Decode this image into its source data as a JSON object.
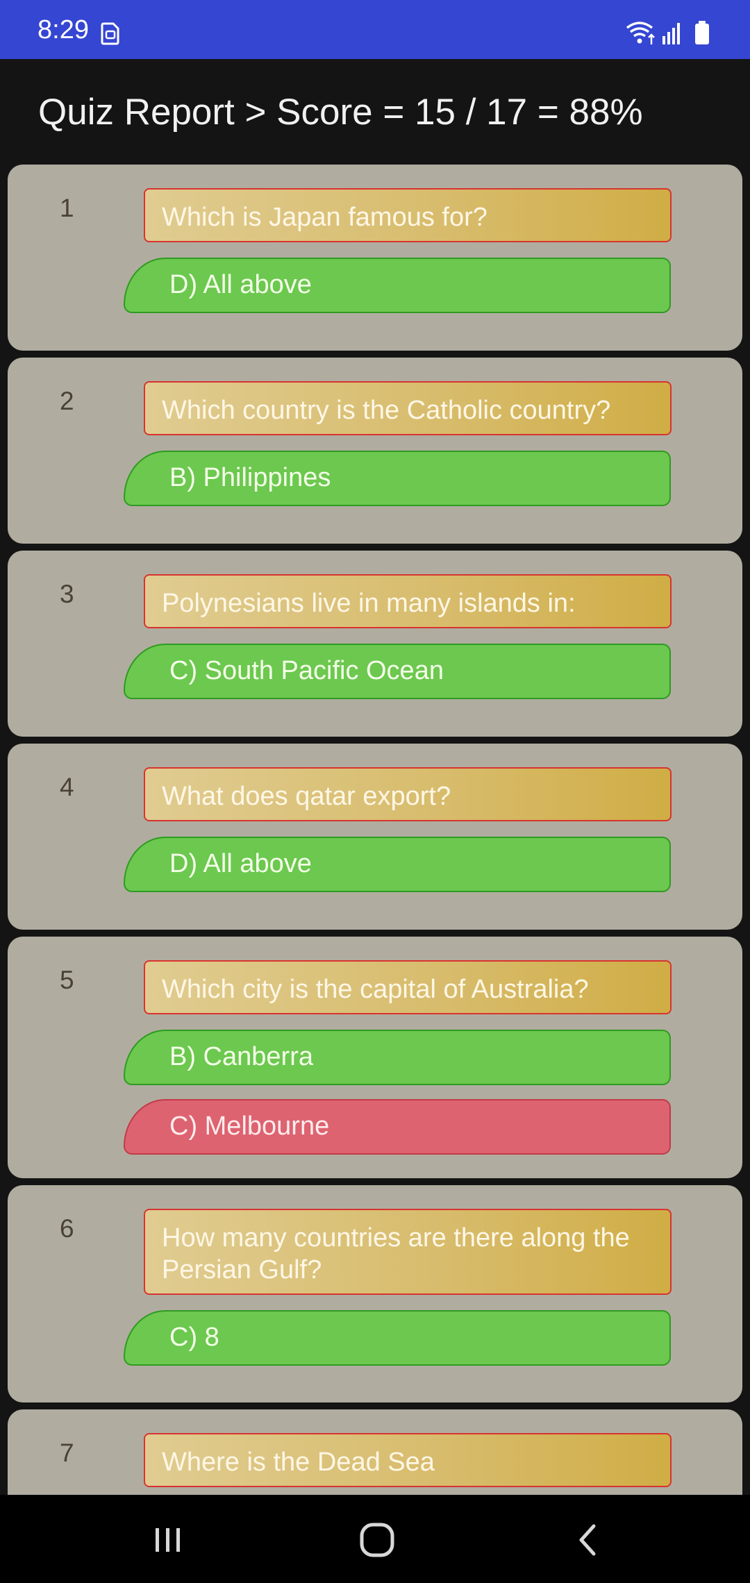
{
  "status_bar": {
    "time": "8:29",
    "background": "#3546d2",
    "icons": [
      "sim-card-icon",
      "wifi-icon",
      "signal-icon",
      "battery-icon"
    ]
  },
  "header": {
    "title": "Quiz Report > Score = 15 / 17 = 88%"
  },
  "colors": {
    "card": "#b0ada0",
    "question_border": "#d8332f",
    "correct_answer": "#6cc84f",
    "wrong_answer": "#dd6370"
  },
  "questions": [
    {
      "number": "1",
      "question": "Which is Japan famous for?",
      "correct": "D) All above"
    },
    {
      "number": "2",
      "question": "Which country is the Catholic country?",
      "correct": "B) Philippines"
    },
    {
      "number": "3",
      "question": "Polynesians live in many islands in:",
      "correct": "C) South Pacific Ocean"
    },
    {
      "number": "4",
      "question": "What does qatar export?",
      "correct": "D) All above"
    },
    {
      "number": "5",
      "question": "Which city is the capital of Australia?",
      "correct": "B) Canberra",
      "wrong": "C) Melbourne"
    },
    {
      "number": "6",
      "question": "How many countries are there along the Persian Gulf?",
      "correct": "C) 8"
    },
    {
      "number": "7",
      "question": "Where is the Dead Sea"
    }
  ],
  "nav": {
    "icons": [
      "recents-icon",
      "home-icon",
      "back-icon"
    ]
  }
}
